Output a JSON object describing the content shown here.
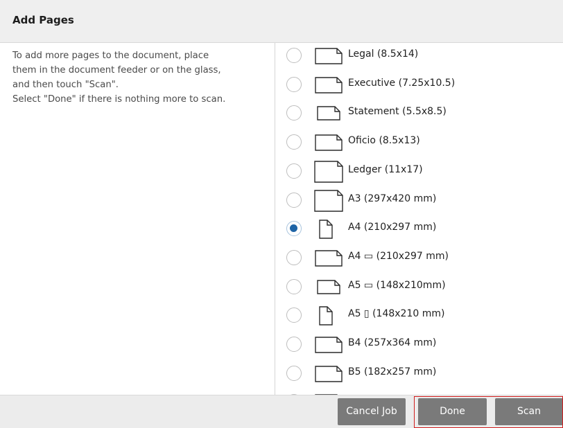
{
  "dialog": {
    "title": "Add Pages"
  },
  "instructions": {
    "lines": [
      "To add more pages to the document, place",
      "them in the document feeder or on the glass,",
      "and then touch \"Scan\".",
      "Select \"Done\" if there is nothing more to scan."
    ]
  },
  "paper_sizes": [
    {
      "label": "Legal (8.5x14)",
      "selected": false,
      "icon": "landscape-page-icon"
    },
    {
      "label": "Executive (7.25x10.5)",
      "selected": false,
      "icon": "landscape-page-icon"
    },
    {
      "label": "Statement (5.5x8.5)",
      "selected": false,
      "icon": "small-landscape-page-icon"
    },
    {
      "label": "Oficio (8.5x13)",
      "selected": false,
      "icon": "landscape-page-icon"
    },
    {
      "label": "Ledger (11x17)",
      "selected": false,
      "icon": "large-landscape-page-icon"
    },
    {
      "label": "A3 (297x420 mm)",
      "selected": false,
      "icon": "large-landscape-page-icon"
    },
    {
      "label": "A4 (210x297 mm)",
      "selected": true,
      "icon": "portrait-page-icon"
    },
    {
      "label": "A4 ▭ (210x297 mm)",
      "selected": false,
      "icon": "landscape-page-icon"
    },
    {
      "label": "A5 ▭ (148x210mm)",
      "selected": false,
      "icon": "small-landscape-page-icon"
    },
    {
      "label": "A5 ▯ (148x210 mm)",
      "selected": false,
      "icon": "portrait-page-icon"
    },
    {
      "label": "B4 (257x364 mm)",
      "selected": false,
      "icon": "landscape-page-icon"
    },
    {
      "label": "B5 (182x257 mm)",
      "selected": false,
      "icon": "landscape-page-icon"
    },
    {
      "label": "",
      "selected": false,
      "icon": "landscape-page-icon"
    }
  ],
  "footer": {
    "cancel_label": "Cancel Job",
    "done_label": "Done",
    "scan_label": "Scan"
  },
  "colors": {
    "selected_radio": "#1e64a6",
    "button_bg": "#7a7a7a",
    "focus_outline": "#d01c1c"
  }
}
